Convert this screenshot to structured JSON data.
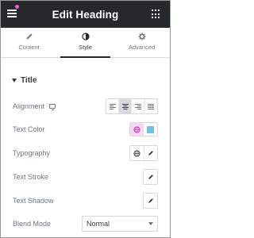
{
  "header": {
    "title": "Edit Heading",
    "menu_icon": "hamburger-icon",
    "apps_icon": "grid-icon",
    "notify_color": "#e85ad8"
  },
  "tabs": [
    {
      "label": "Content",
      "icon": "pencil-icon",
      "active": false
    },
    {
      "label": "Style",
      "icon": "contrast-icon",
      "active": true
    },
    {
      "label": "Advanced",
      "icon": "gear-icon",
      "active": false
    }
  ],
  "section": {
    "title": "Title",
    "expanded": true
  },
  "controls": {
    "alignment": {
      "label": "Alignment",
      "options": [
        "left",
        "center",
        "right",
        "justify"
      ],
      "selected": "center",
      "device_icon": "desktop-icon"
    },
    "text_color": {
      "label": "Text Color",
      "swatch": "#6ec1e4",
      "global_icon": "globe-icon"
    },
    "typography": {
      "label": "Typography",
      "global_icon": "globe-icon",
      "edit_icon": "pencil-icon"
    },
    "text_stroke": {
      "label": "Text Stroke",
      "edit_icon": "pencil-icon"
    },
    "text_shadow": {
      "label": "Text Shadow",
      "edit_icon": "pencil-icon"
    },
    "blend_mode": {
      "label": "Blend Mode",
      "value": "Normal"
    }
  }
}
